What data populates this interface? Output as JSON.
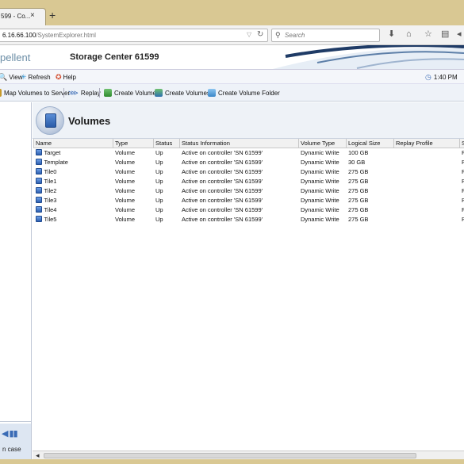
{
  "browser": {
    "tab_title": "599 - Co...",
    "tab_close": "×",
    "new_tab": "+",
    "url_host": "6.16.66.100",
    "url_path": "/SystemExplorer.html",
    "search_placeholder": "Search"
  },
  "app": {
    "brand": "pellent",
    "title": "Storage Center 61599"
  },
  "menu": {
    "items": [
      "View",
      "Refresh",
      "Help"
    ],
    "time": "1:40 PM"
  },
  "toolbar": {
    "map_volumes": "Map Volumes to Server",
    "replay": "Replay",
    "create_volume": "Create Volume",
    "create_volumes": "Create Volumes",
    "create_volume_folder": "Create Volume Folder"
  },
  "left_panel": {
    "case_label": "n case"
  },
  "volumes": {
    "title": "Volumes",
    "columns": [
      "Name",
      "Type",
      "Status",
      "Status Information",
      "Volume Type",
      "Logical Size",
      "Replay Profile",
      "S"
    ],
    "rows": [
      {
        "name": "Target",
        "type": "Volume",
        "status": "Up",
        "info": "Active on controller 'SN 61599'",
        "vtype": "Dynamic Write",
        "size": "100 GB",
        "replay": "",
        "s": "R"
      },
      {
        "name": "Template",
        "type": "Volume",
        "status": "Up",
        "info": "Active on controller 'SN 61599'",
        "vtype": "Dynamic Write",
        "size": "30 GB",
        "replay": "",
        "s": "R"
      },
      {
        "name": "Tile0",
        "type": "Volume",
        "status": "Up",
        "info": "Active on controller 'SN 61599'",
        "vtype": "Dynamic Write",
        "size": "275 GB",
        "replay": "",
        "s": "R"
      },
      {
        "name": "Tile1",
        "type": "Volume",
        "status": "Up",
        "info": "Active on controller 'SN 61599'",
        "vtype": "Dynamic Write",
        "size": "275 GB",
        "replay": "",
        "s": "R"
      },
      {
        "name": "Tile2",
        "type": "Volume",
        "status": "Up",
        "info": "Active on controller 'SN 61599'",
        "vtype": "Dynamic Write",
        "size": "275 GB",
        "replay": "",
        "s": "R"
      },
      {
        "name": "Tile3",
        "type": "Volume",
        "status": "Up",
        "info": "Active on controller 'SN 61599'",
        "vtype": "Dynamic Write",
        "size": "275 GB",
        "replay": "",
        "s": "R"
      },
      {
        "name": "Tile4",
        "type": "Volume",
        "status": "Up",
        "info": "Active on controller 'SN 61599'",
        "vtype": "Dynamic Write",
        "size": "275 GB",
        "replay": "",
        "s": "R"
      },
      {
        "name": "Tile5",
        "type": "Volume",
        "status": "Up",
        "info": "Active on controller 'SN 61599'",
        "vtype": "Dynamic Write",
        "size": "275 GB",
        "replay": "",
        "s": "R"
      }
    ]
  },
  "colors": {
    "titlebar": "#d9c893",
    "accent": "#2d5fb0"
  }
}
